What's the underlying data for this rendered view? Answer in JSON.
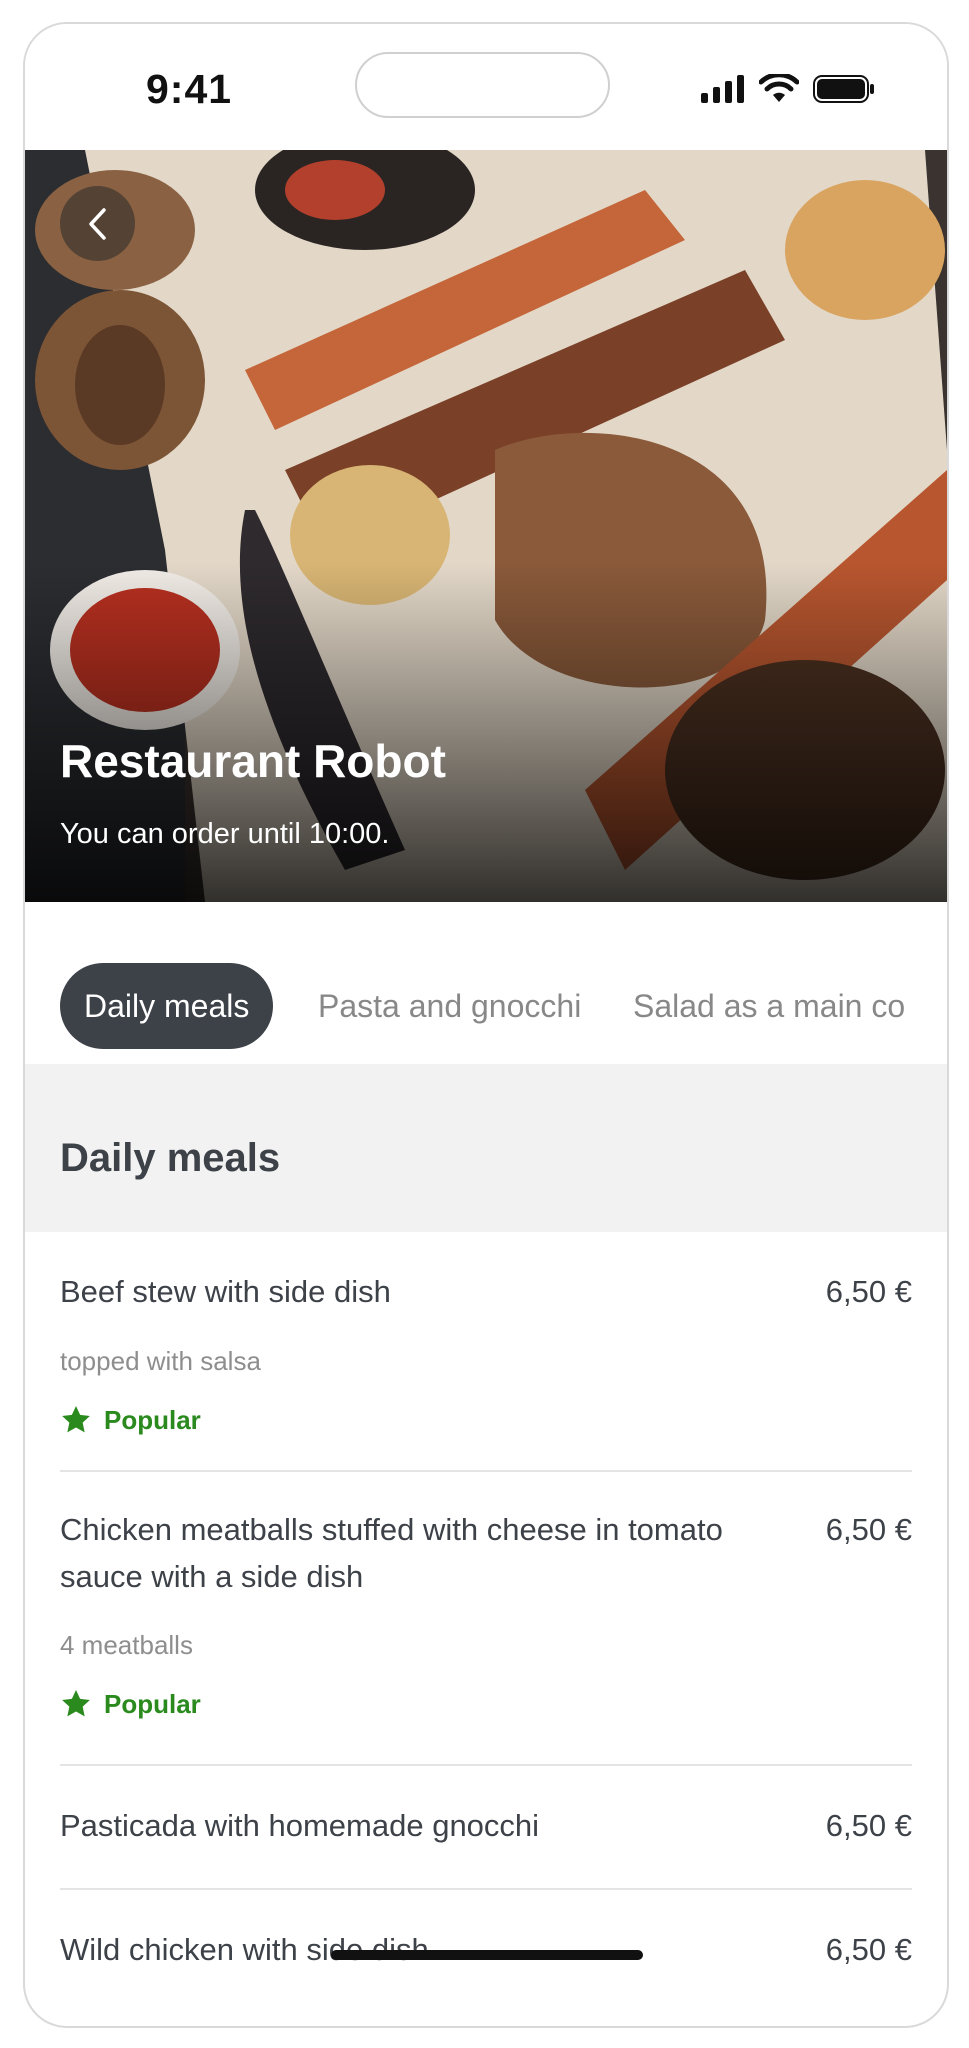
{
  "status_bar": {
    "time": "9:41"
  },
  "hero": {
    "title": "Restaurant Robot",
    "subtitle": "You can order until 10:00."
  },
  "tabs": [
    {
      "label": "Daily meals",
      "active": true
    },
    {
      "label": "Pasta and gnocchi",
      "active": false
    },
    {
      "label": "Salad as a main co",
      "active": false
    }
  ],
  "section": {
    "title": "Daily meals"
  },
  "menu_items": [
    {
      "name": "Beef stew with side dish",
      "price": "6,50 €",
      "description": "topped with salsa",
      "badge": "Popular"
    },
    {
      "name": "Chicken meatballs stuffed with cheese in tomato sauce with a side dish",
      "price": "6,50 €",
      "description": "4 meatballs",
      "badge": "Popular"
    },
    {
      "name": "Pasticada with homemade gnocchi",
      "price": "6,50 €"
    },
    {
      "name": "Wild chicken with side dish",
      "price": "6,50 €"
    }
  ],
  "colors": {
    "badge_green": "#2a8a1e",
    "tab_active_bg": "#3d4148",
    "section_bg": "#f2f2f2"
  },
  "icons": {
    "back": "chevron-left-icon",
    "badge": "star-icon"
  }
}
